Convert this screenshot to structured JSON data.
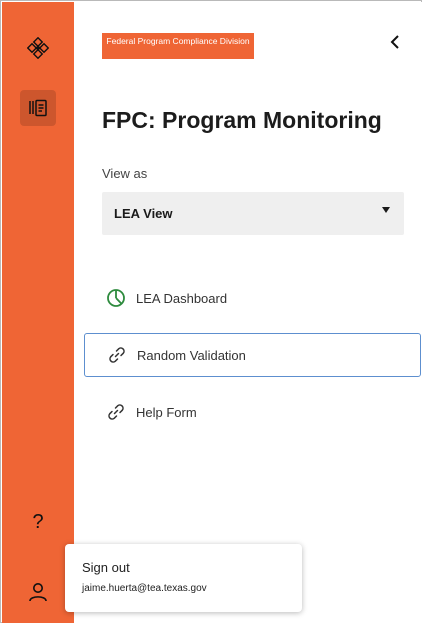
{
  "rail": {
    "items": [
      {
        "icon": "diamond-cluster-logo-icon"
      },
      {
        "icon": "pages-icon",
        "active": true
      },
      {
        "icon": "help-icon",
        "glyph": "?"
      },
      {
        "icon": "account-icon"
      }
    ]
  },
  "panel": {
    "brand_logo_text": "Federal Program Compliance Division",
    "title": "FPC: Program Monitoring",
    "view_as": {
      "label": "View as",
      "selected": "LEA View"
    },
    "nav": [
      {
        "label": "LEA Dashboard",
        "icon": "pie-chart-icon"
      },
      {
        "label": "Random Validation",
        "icon": "link-icon",
        "selected": true
      },
      {
        "label": "Help Form",
        "icon": "link-icon"
      }
    ]
  },
  "account_popover": {
    "title": "Sign out",
    "email": "jaime.huerta@tea.texas.gov"
  },
  "colors": {
    "rail": "#ef6535",
    "selected_border": "#5d8fcf",
    "dashboard_icon": "#2e8b3e"
  }
}
